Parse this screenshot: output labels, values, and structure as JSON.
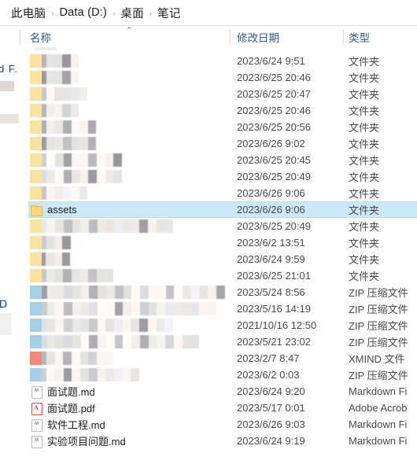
{
  "window": {
    "title": "笔记",
    "app": "file-explorer"
  },
  "breadcrumb": {
    "separator": "›",
    "items": [
      {
        "label": "此电脑"
      },
      {
        "label": "Data (D:)"
      },
      {
        "label": "桌面"
      },
      {
        "label": "笔记"
      }
    ]
  },
  "columns": {
    "name": "名称",
    "date_modified": "修改日期",
    "type": "类型",
    "sort_caret": "⌃",
    "sorted_by": "名称",
    "sort_direction": "ascending"
  },
  "types": {
    "folder": "文件夹",
    "zip": "ZIP 压缩文件",
    "xmind": "XMIND 文件",
    "markdown": "Markdown Fi",
    "pdf": "Adobe Acrob"
  },
  "colors": {
    "selection_fill": "#cce8f7",
    "selection_border": "#b5def2",
    "header_text": "#3d5a80",
    "body_text": "#4a4a4a",
    "folder_icon": "#fcd975",
    "pdf_icon": "#d93a2b",
    "xmind_icon": "#f08b78",
    "zip_icon": "#a8cfe8"
  },
  "rows": [
    {
      "name": "",
      "censored": true,
      "icon": "folder-icon",
      "mosaic_width": 62,
      "date": "2023/6/24 9:51",
      "type": "文件夹",
      "selected": false
    },
    {
      "name": "",
      "censored": true,
      "icon": "folder-icon",
      "mosaic_width": 62,
      "date": "2023/6/25 20:46",
      "type": "文件夹",
      "selected": false
    },
    {
      "name": "",
      "censored": true,
      "icon": "folder-icon",
      "mosaic_width": 73,
      "date": "2023/6/25 20:47",
      "type": "文件夹",
      "selected": false
    },
    {
      "name": "",
      "censored": true,
      "icon": "folder-icon",
      "mosaic_width": 62,
      "date": "2023/6/25 20:46",
      "type": "文件夹",
      "selected": false
    },
    {
      "name": "",
      "censored": true,
      "icon": "folder-icon",
      "mosaic_width": 84,
      "date": "2023/6/25 20:56",
      "type": "文件夹",
      "selected": false
    },
    {
      "name": "",
      "censored": true,
      "icon": "folder-icon",
      "mosaic_width": 84,
      "date": "2023/6/26 9:02",
      "type": "文件夹",
      "selected": false
    },
    {
      "name": "",
      "censored": true,
      "icon": "folder-icon",
      "mosaic_width": 117,
      "date": "2023/6/25 20:45",
      "type": "文件夹",
      "selected": false
    },
    {
      "name": "",
      "censored": true,
      "icon": "folder-icon",
      "mosaic_width": 117,
      "date": "2023/6/25 20:49",
      "type": "文件夹",
      "selected": false
    },
    {
      "name": "",
      "censored": true,
      "icon": "folder-icon",
      "mosaic_width": 73,
      "date": "2023/6/26 9:06",
      "type": "文件夹",
      "selected": false
    },
    {
      "name": "assets",
      "censored": false,
      "icon": "folder-icon",
      "mosaic_width": 0,
      "date": "2023/6/26 9:06",
      "type": "文件夹",
      "selected": true
    },
    {
      "name": "",
      "censored": true,
      "icon": "folder-icon",
      "mosaic_width": 182,
      "date": "2023/6/25 20:49",
      "type": "文件夹",
      "selected": false
    },
    {
      "name": "",
      "censored": true,
      "icon": "folder-icon",
      "mosaic_width": 62,
      "date": "2023/6/2 13:51",
      "type": "文件夹",
      "selected": false
    },
    {
      "name": "",
      "censored": true,
      "icon": "folder-icon",
      "mosaic_width": 51,
      "date": "2023/6/24 9:59",
      "type": "文件夹",
      "selected": false
    },
    {
      "name": "",
      "censored": true,
      "icon": "folder-icon",
      "mosaic_width": 106,
      "date": "2023/6/25 21:01",
      "type": "文件夹",
      "selected": false
    },
    {
      "name": "",
      "censored": true,
      "icon": "zip-icon",
      "mosaic_width": 248,
      "date": "2023/5/24 8:56",
      "type": "ZIP 压缩文件",
      "selected": false
    },
    {
      "name": "",
      "censored": true,
      "icon": "zip-icon",
      "mosaic_width": 237,
      "date": "2023/5/16 14:19",
      "type": "ZIP 压缩文件",
      "selected": false
    },
    {
      "name": "",
      "censored": true,
      "icon": "zip-icon",
      "mosaic_width": 182,
      "date": "2021/10/16 12:50",
      "type": "ZIP 压缩文件",
      "selected": false
    },
    {
      "name": "",
      "censored": true,
      "icon": "zip-icon",
      "mosaic_width": 215,
      "date": "2023/5/21 23:02",
      "type": "ZIP 压缩文件",
      "selected": false
    },
    {
      "name": "",
      "censored": true,
      "icon": "xmind-icon",
      "mosaic_width": 106,
      "date": "2023/2/7 8:47",
      "type": "XMIND 文件",
      "selected": false
    },
    {
      "name": "",
      "censored": true,
      "icon": "zip-icon",
      "mosaic_width": 139,
      "date": "2023/6/2 0:03",
      "type": "ZIP 压缩文件",
      "selected": false
    },
    {
      "name": "面试题.md",
      "censored": false,
      "icon": "markdown-icon",
      "mosaic_width": 0,
      "date": "2023/6/24 9:20",
      "type": "Markdown Fi",
      "selected": false
    },
    {
      "name": "面试题.pdf",
      "censored": false,
      "icon": "pdf-icon",
      "mosaic_width": 0,
      "date": "2023/5/17 0:01",
      "type": "Adobe Acrob",
      "selected": false
    },
    {
      "name": "软件工程.md",
      "censored": false,
      "icon": "markdown-icon",
      "mosaic_width": 0,
      "date": "2023/6/26 9:03",
      "type": "Markdown Fi",
      "selected": false
    },
    {
      "name": "实验项目问题.md",
      "censored": false,
      "icon": "markdown-icon",
      "mosaic_width": 0,
      "date": "2023/6/24 9:19",
      "type": "Markdown Fi",
      "selected": false
    }
  ],
  "edge_artifacts": {
    "text_1": "d F.",
    "text_2": "D"
  }
}
